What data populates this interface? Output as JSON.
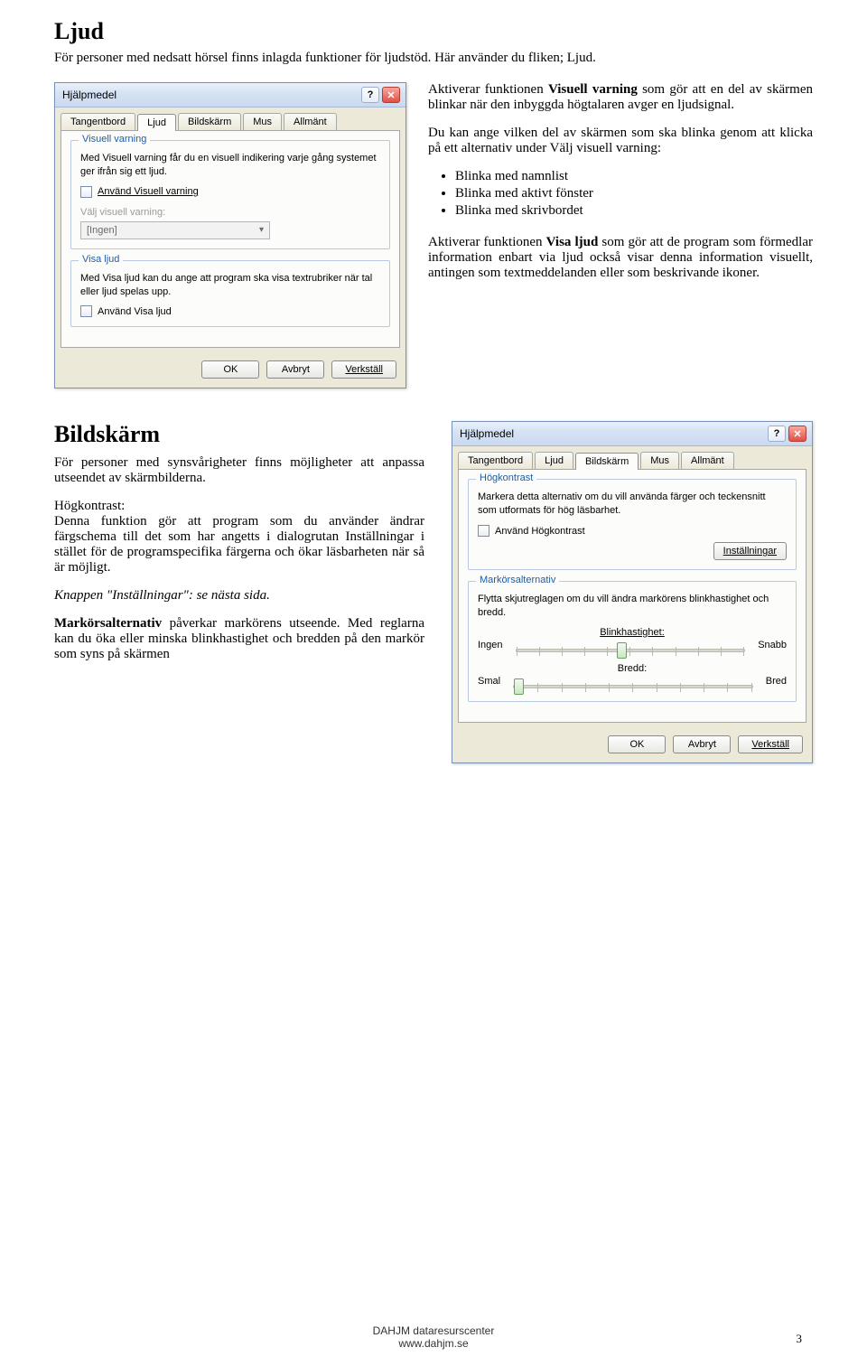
{
  "doc": {
    "h_ljud": "Ljud",
    "intro_ljud": "För personer med nedsatt hörsel finns inlagda funktioner för ljudstöd. Här använder du fliken; Ljud.",
    "p1a": "Aktiverar funktionen ",
    "p1b": "Visuell varning",
    "p1c": " som gör att en del av skärmen blinkar när den inbyggda högtalaren avger en ljudsignal.",
    "p2": "Du kan ange vilken del av skärmen som ska blinka genom att klicka på ett alternativ under Välj visuell varning:",
    "bullets": [
      "Blinka med namnlist",
      "Blinka med aktivt fönster",
      "Blinka med skrivbordet"
    ],
    "p3a": "Aktiverar funktionen ",
    "p3b": "Visa ljud",
    "p3c": " som gör att de program som förmedlar information enbart via ljud också visar denna information visuellt, antingen som textmeddelanden eller som beskrivande ikoner.",
    "h_bild": "Bildskärm",
    "bild_p1": "För personer med synsvårigheter finns möjligheter att anpassa utseendet av skärmbilderna.",
    "bild_p2a": "Högkontrast:",
    "bild_p2b": "Denna funktion gör att program som du använder ändrar färgschema till det som har angetts i dialogrutan Inställningar i stället för de programspecifika färgerna och ökar läsbarheten när så är möjligt.",
    "bild_p3": "Knappen \"Inställningar\": se nästa sida.",
    "bild_p4a": "Markörsalternativ",
    "bild_p4b": " påverkar markörens utseende. Med reglarna kan du öka eller minska blinkhastighet och bredden på den markör som syns på skärmen"
  },
  "dialog1": {
    "title": "Hjälpmedel",
    "tabs": [
      "Tangentbord",
      "Ljud",
      "Bildskärm",
      "Mus",
      "Allmänt"
    ],
    "active_tab_ix": 1,
    "group1_legend": "Visuell varning",
    "group1_desc": "Med Visuell varning får du en visuell indikering varje gång systemet ger ifrån sig ett ljud.",
    "group1_check": "Använd Visuell varning",
    "select_label": "Välj visuell varning:",
    "select_value": "[Ingen]",
    "group2_legend": "Visa ljud",
    "group2_desc": "Med Visa ljud kan du ange att program ska visa textrubriker när tal eller ljud spelas upp.",
    "group2_check": "Använd Visa ljud",
    "ok": "OK",
    "cancel": "Avbryt",
    "apply": "Verkställ"
  },
  "dialog2": {
    "title": "Hjälpmedel",
    "tabs": [
      "Tangentbord",
      "Ljud",
      "Bildskärm",
      "Mus",
      "Allmänt"
    ],
    "active_tab_ix": 2,
    "group1_legend": "Högkontrast",
    "group1_desc": "Markera detta alternativ om du vill använda färger och teckensnitt som utformats för hög läsbarhet.",
    "group1_check": "Använd Högkontrast",
    "settings_btn": "Inställningar",
    "group2_legend": "Markörsalternativ",
    "group2_desc": "Flytta skjutreglagen om du vill ändra markörens blinkhastighet och bredd.",
    "rate_label": "Blinkhastighet:",
    "rate_min": "Ingen",
    "rate_max": "Snabb",
    "width_label": "Bredd:",
    "width_min": "Smal",
    "width_max": "Bred",
    "ok": "OK",
    "cancel": "Avbryt",
    "apply": "Verkställ"
  },
  "footer": {
    "line1": "DAHJM dataresurscenter",
    "line2": "www.dahjm.se",
    "page": "3"
  }
}
